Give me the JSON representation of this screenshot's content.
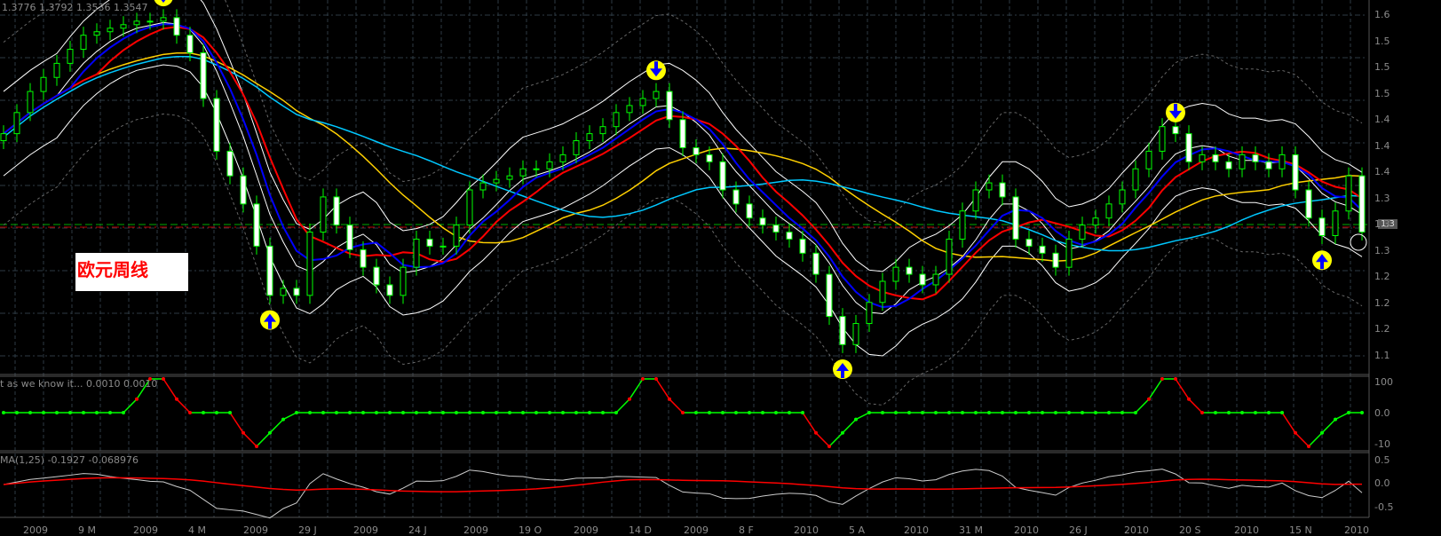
{
  "header": {
    "ohlc": "1.3776 1.3792 1.3536 1.3547"
  },
  "note_label": "欧元周线",
  "indicator1": {
    "label": "t as we know it... 0.0010 0.0010",
    "axis": [
      "100",
      "0.0",
      "-10"
    ]
  },
  "indicator2": {
    "label": "MA(1,25) -0.1927 -0.068976",
    "axis": [
      "0.5",
      "0.0",
      "-0.5"
    ]
  },
  "price_axis": [
    "1.6",
    "1.5",
    "1.5",
    "1.5",
    "1.4",
    "1.4",
    "1.4",
    "1.3",
    "1.3",
    "1.3",
    "1.2",
    "1.2",
    "1.2",
    "1.1"
  ],
  "current_price": "1.3",
  "date_axis": [
    "2009",
    "9 M",
    "2009",
    "4 M",
    "2009",
    "29 J",
    "2009",
    "24 J",
    "2009",
    "19 O",
    "2009",
    "14 D",
    "2009",
    "8 F",
    "2010",
    "5 A",
    "2010",
    "31 M",
    "2010",
    "26 J",
    "2010",
    "20 S",
    "2010",
    "15 N",
    "2010"
  ],
  "colors": {
    "bull": "#00ff00",
    "bear_body": "#ffffff",
    "fast_ma": "#0000ff",
    "slow_ma": "#ff0000",
    "long_ma": "#ffd000",
    "mid_ma": "#00c8ff",
    "band": "#ffffff",
    "signal": "#ffff00"
  },
  "chart_data": {
    "type": "candlestick",
    "title": "EURUSD Weekly",
    "ylim": [
      1.1,
      1.62
    ],
    "close": [
      1.44,
      1.47,
      1.5,
      1.52,
      1.54,
      1.56,
      1.58,
      1.585,
      1.59,
      1.595,
      1.6,
      1.6,
      1.605,
      1.58,
      1.555,
      1.49,
      1.415,
      1.38,
      1.34,
      1.28,
      1.21,
      1.22,
      1.21,
      1.3,
      1.35,
      1.31,
      1.275,
      1.25,
      1.225,
      1.21,
      1.25,
      1.29,
      1.28,
      1.28,
      1.31,
      1.36,
      1.37,
      1.375,
      1.38,
      1.39,
      1.39,
      1.4,
      1.41,
      1.43,
      1.44,
      1.45,
      1.47,
      1.48,
      1.49,
      1.5,
      1.46,
      1.42,
      1.41,
      1.4,
      1.36,
      1.34,
      1.32,
      1.31,
      1.3,
      1.29,
      1.27,
      1.24,
      1.18,
      1.14,
      1.17,
      1.2,
      1.23,
      1.25,
      1.24,
      1.225,
      1.24,
      1.29,
      1.33,
      1.36,
      1.37,
      1.35,
      1.29,
      1.28,
      1.27,
      1.25,
      1.29,
      1.31,
      1.32,
      1.34,
      1.36,
      1.39,
      1.415,
      1.45,
      1.44,
      1.4,
      1.41,
      1.4,
      1.39,
      1.41,
      1.4,
      1.39,
      1.41,
      1.36,
      1.32,
      1.295,
      1.33,
      1.38,
      1.3
    ],
    "sell_signals": [
      12,
      49,
      88
    ],
    "buy_signals": [
      20,
      63,
      99
    ],
    "indicator1_range": [
      -100,
      100
    ],
    "indicator2_range": [
      -0.5,
      0.5
    ]
  }
}
